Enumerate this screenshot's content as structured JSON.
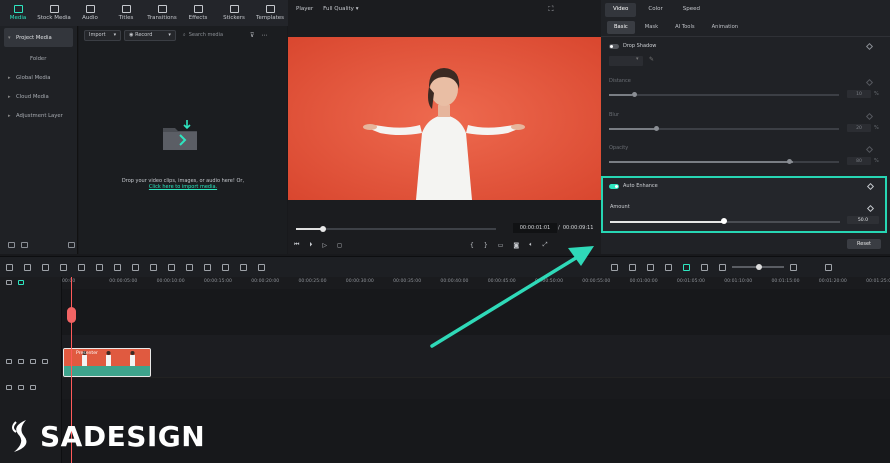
{
  "toolbar": {
    "items": [
      {
        "label": "Media",
        "icon": "media-icon",
        "active": true
      },
      {
        "label": "Stock Media",
        "icon": "stock-media-icon"
      },
      {
        "label": "Audio",
        "icon": "audio-icon"
      },
      {
        "label": "Titles",
        "icon": "titles-icon"
      },
      {
        "label": "Transitions",
        "icon": "transitions-icon"
      },
      {
        "label": "Effects",
        "icon": "effects-icon"
      },
      {
        "label": "Stickers",
        "icon": "stickers-icon"
      },
      {
        "label": "Templates",
        "icon": "templates-icon"
      }
    ]
  },
  "sidebar": {
    "items": [
      {
        "label": "Project Media"
      },
      {
        "label": "Folder"
      },
      {
        "label": "Global Media"
      },
      {
        "label": "Cloud Media"
      },
      {
        "label": "Adjustment Layer"
      }
    ]
  },
  "media": {
    "import_label": "Import",
    "record_label": "Record",
    "search_placeholder": "Search media",
    "drop_text": "Drop your video clips, images, or audio here! Or,",
    "drop_link": "Click here to import media."
  },
  "player": {
    "label": "Player",
    "quality": "Full Quality",
    "current_time": "00:00:01:01",
    "separator": "/",
    "total_time": "00:00:09:11",
    "progress": 0.11
  },
  "properties": {
    "tabs": [
      "Video",
      "Color",
      "Speed"
    ],
    "subtabs": [
      "Basic",
      "Mask",
      "AI Tools",
      "Animation"
    ],
    "drop_shadow_label": "Drop Shadow",
    "distance": {
      "label": "Distance",
      "value": "10",
      "unit": "%",
      "level": 0.1
    },
    "blur": {
      "label": "Blur",
      "value": "20",
      "unit": "%",
      "level": 0.2
    },
    "opacity": {
      "label": "Opacity",
      "value": "80",
      "unit": "%",
      "level": 0.8
    },
    "auto_enhance_label": "Auto Enhance",
    "amount": {
      "label": "Amount",
      "value": "50.0",
      "level": 0.5
    },
    "reset_label": "Reset"
  },
  "timeline": {
    "ticks": [
      "00:00",
      "00:00:05:00",
      "00:00:10:00",
      "00:00:15:00",
      "00:00:20:00",
      "00:00:25:00",
      "00:00:30:00",
      "00:00:35:00",
      "00:00:40:00",
      "00:00:45:00",
      "00:00:50:00",
      "00:00:55:00",
      "00:01:00:00",
      "00:01:05:00",
      "00:01:10:00",
      "00:01:15:00",
      "00:01:20:00",
      "00:01:25:00"
    ],
    "clip_label": "Presenter"
  },
  "colors": {
    "accent": "#2ee6c0",
    "highlight": "#27d6b4",
    "video_bg": "#e3533c",
    "playhead": "#ff5a5a"
  },
  "brand": {
    "name": "SADESIGN"
  }
}
